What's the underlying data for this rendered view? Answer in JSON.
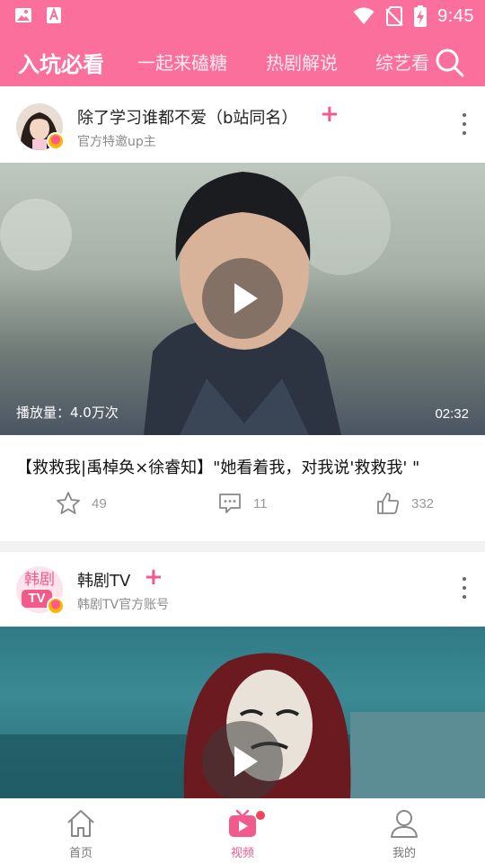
{
  "status_bar": {
    "time": "9:45"
  },
  "header": {
    "tabs": [
      {
        "label": "入坑必看",
        "active": true
      },
      {
        "label": "一起来磕糖",
        "active": false
      },
      {
        "label": "热剧解说",
        "active": false
      },
      {
        "label": "综艺看",
        "active": false
      }
    ],
    "accent_color": "#fb6f9c"
  },
  "feed": [
    {
      "author_name": "除了学习谁都不爱（b站同名）",
      "author_sub": "官方特邀up主",
      "views": "播放量：4.0万次",
      "duration": "02:32",
      "title": "【救救我|禹棹奂×徐睿知】\"她看着我，对我说'救救我' \"",
      "favorites": "49",
      "comments": "11",
      "likes": "332"
    },
    {
      "author_name": "韩剧TV",
      "author_sub": "韩剧TV官方账号",
      "avatar_text_top": "韩剧",
      "avatar_text_bottom": "TV"
    }
  ],
  "bottom_nav": [
    {
      "label": "首页",
      "icon": "home-icon",
      "active": false
    },
    {
      "label": "视频",
      "icon": "tv-play-icon",
      "active": true
    },
    {
      "label": "我的",
      "icon": "person-icon",
      "active": false
    }
  ]
}
